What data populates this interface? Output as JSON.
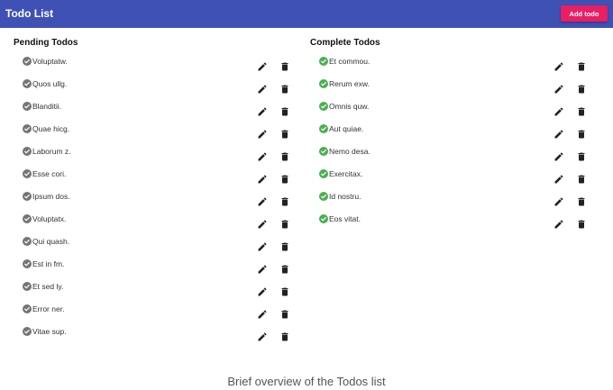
{
  "header": {
    "title": "Todo List",
    "add_label": "Add todo"
  },
  "pending": {
    "title": "Pending Todos",
    "items": [
      "Voluptatw.",
      "Quos ullg.",
      "Blanditii.",
      "Quae hicg.",
      "Laborum z.",
      "Esse cori.",
      "Ipsum dos.",
      "Voluptatx.",
      "Qui quash.",
      "Est in fm.",
      "Et sed ly.",
      "Error ner.",
      "Vitae sup."
    ]
  },
  "complete": {
    "title": "Complete Todos",
    "items": [
      "Et commou.",
      "Rerum exw.",
      "Omnis quw.",
      "Aut quiae.",
      "Nemo desa.",
      "Exercitax.",
      "Id nostru.",
      "Eos vitat."
    ]
  },
  "caption": "Brief overview of the Todos list",
  "colors": {
    "appbar": "#3f51b5",
    "add_button": "#e91e63",
    "pending_check": "#757575",
    "complete_check": "#4caf50"
  },
  "icons": {
    "status": "check-circle-icon",
    "edit": "pencil-icon",
    "delete": "trash-icon"
  }
}
